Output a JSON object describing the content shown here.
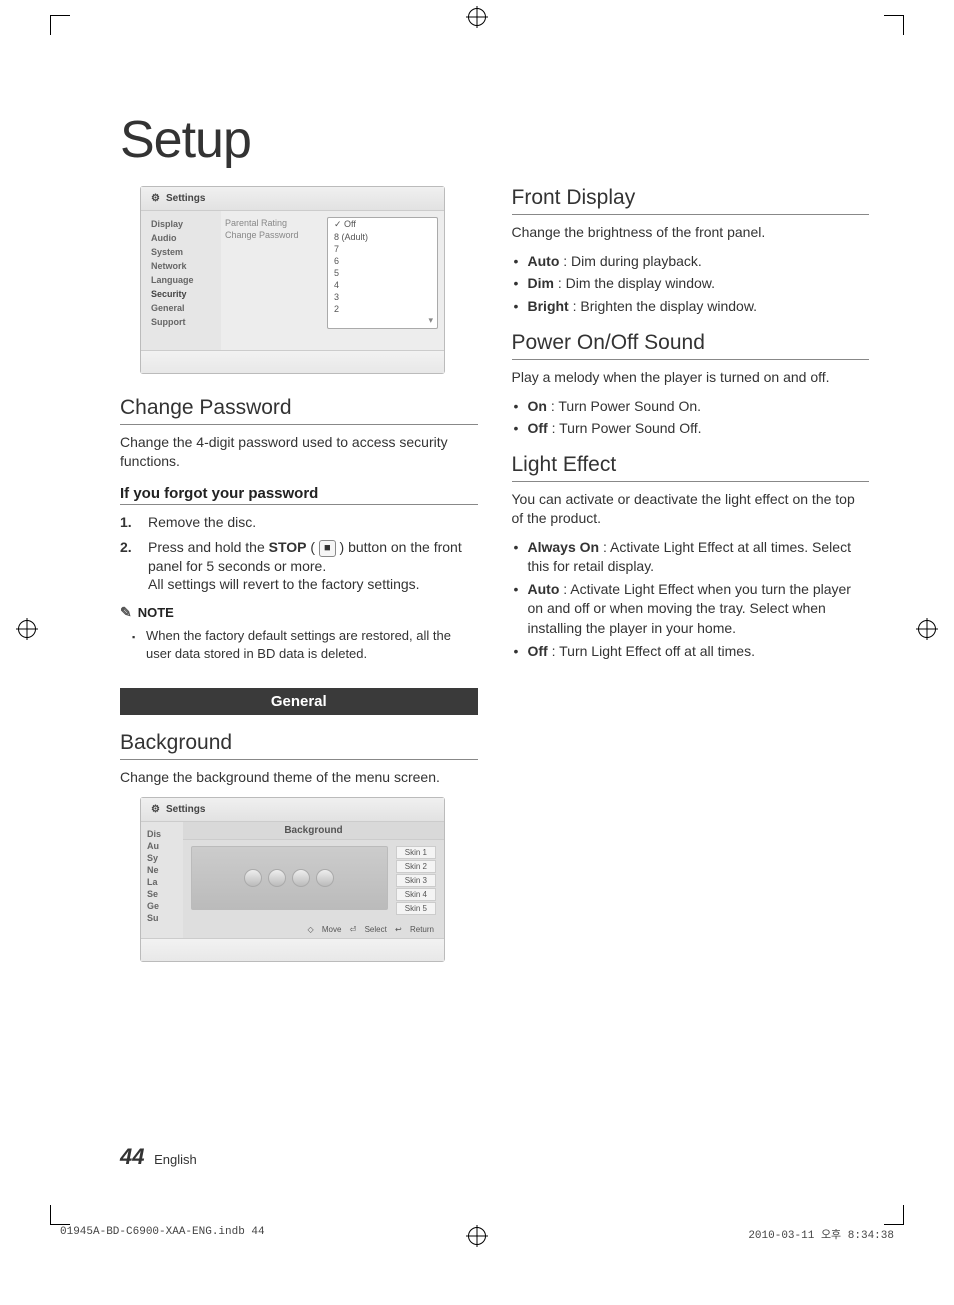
{
  "page": {
    "title": "Setup",
    "number": "44",
    "lang": "English"
  },
  "panel1": {
    "header": "Settings",
    "menu": [
      "Display",
      "Audio",
      "System",
      "Network",
      "Language",
      "Security",
      "General",
      "Support"
    ],
    "menu_selected": "Security",
    "mid": [
      "Parental Rating",
      "Change Password"
    ],
    "options": [
      "Off",
      "8 (Adult)",
      "7",
      "6",
      "5",
      "4",
      "3",
      "2"
    ],
    "option_checked": "Off"
  },
  "sec_change_pw": {
    "title": "Change Password",
    "desc": "Change the 4-digit password used to access security functions.",
    "forgot_title": "If you forgot your password",
    "steps": [
      "Remove the disc.",
      "Press and hold the STOP button on the front panel for 5 seconds or more. All settings will revert to the factory settings."
    ],
    "stop_label": "STOP",
    "note_label": "NOTE",
    "note_items": [
      "When the factory default settings are restored, all the user data stored in BD data is deleted."
    ]
  },
  "bar_general": "General",
  "sec_background": {
    "title": "Background",
    "desc": "Change the background theme of the menu screen."
  },
  "panel2": {
    "header": "Settings",
    "menu": [
      "Dis",
      "Au",
      "Sy",
      "Ne",
      "La",
      "Se",
      "Ge",
      "Su"
    ],
    "main_title": "Background",
    "skins": [
      "Skin 1",
      "Skin 2",
      "Skin 3",
      "Skin 4",
      "Skin 5"
    ],
    "hints": {
      "move": "Move",
      "select": "Select",
      "return": "Return"
    }
  },
  "sec_front_display": {
    "title": "Front Display",
    "desc": "Change the brightness of the front panel.",
    "items": [
      {
        "b": "Auto",
        "t": " : Dim during playback."
      },
      {
        "b": "Dim",
        "t": " : Dim the display window."
      },
      {
        "b": "Bright",
        "t": " : Brighten the display window."
      }
    ]
  },
  "sec_power_sound": {
    "title": "Power On/Off Sound",
    "desc": "Play a melody when the player is turned on and off.",
    "items": [
      {
        "b": "On",
        "t": " : Turn Power Sound On."
      },
      {
        "b": "Off",
        "t": " : Turn Power Sound Off."
      }
    ]
  },
  "sec_light": {
    "title": "Light Effect",
    "desc": "You can activate or deactivate the light effect on the top of the product.",
    "items": [
      {
        "b": "Always On",
        "t": " : Activate Light Effect at all times. Select this for retail display."
      },
      {
        "b": "Auto",
        "t": " : Activate Light Effect when you turn the player on and off or when moving the tray. Select when installing the player in your home."
      },
      {
        "b": "Off",
        "t": " : Turn Light Effect off at all times."
      }
    ]
  },
  "print": {
    "left": "01945A-BD-C6900-XAA-ENG.indb   44",
    "right": "2010-03-11   오후 8:34:38"
  }
}
